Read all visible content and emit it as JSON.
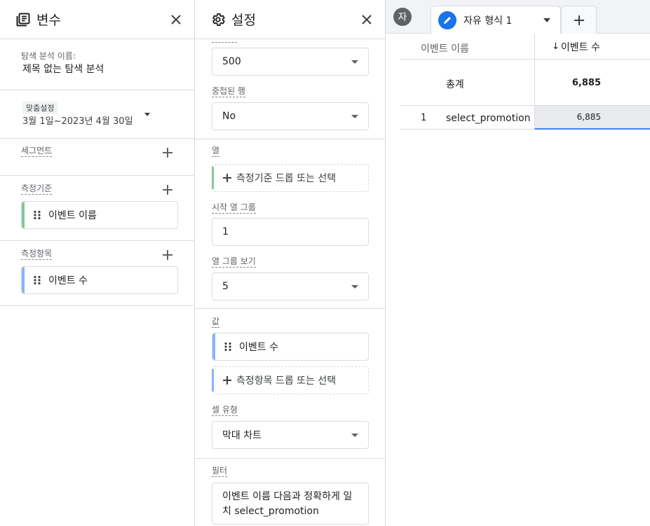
{
  "vars_panel": {
    "title": "변수",
    "exploration_name_label": "탐색 분석 이름:",
    "exploration_name": "제목 없는 탐색 분석",
    "date_badge": "맞춤설정",
    "date_range": "3월 1일~2023년 4월 30일",
    "segments_label": "세그먼트",
    "dimensions_label": "측정기준",
    "dimension_item": "이벤트 이름",
    "metrics_label": "측정항목",
    "metric_item": "이벤트 수"
  },
  "settings_panel": {
    "title": "설정",
    "rows_value": "500",
    "nested_rows_label": "중첩된 행",
    "nested_rows_value": "No",
    "columns_label": "열",
    "columns_drop": "측정기준 드롭 또는 선택",
    "start_col_group_label": "시작 열 그룹",
    "start_col_group_value": "1",
    "show_col_groups_label": "열 그룹 보기",
    "show_col_groups_value": "5",
    "values_label": "값",
    "value_item": "이벤트 수",
    "values_drop": "측정항목 드롭 또는 선택",
    "cell_type_label": "셀 유형",
    "cell_type_value": "막대 차트",
    "filters_label": "필터",
    "filter_text": "이벤트 이름 다음과 정확하게 일치 select_promotion"
  },
  "report": {
    "avatar_letter": "자",
    "tab_name": "자유 형식 1",
    "table": {
      "col_dimension": "이벤트 이름",
      "col_metric": "이벤트 수",
      "sort_arrow": "↓",
      "total_label": "총계",
      "total_value": "6,885",
      "rows": [
        {
          "index": "1",
          "name": "select_promotion",
          "value": "6,885"
        }
      ]
    }
  },
  "colors": {
    "dimension_accent": "#81c995",
    "metric_accent": "#8ab4f8",
    "tab_icon": "#1a73e8",
    "highlight_underline": "#4285f4"
  },
  "icons": {
    "vars_header": "list-document-icon",
    "settings_header": "gear-icon",
    "close": "close-icon",
    "add": "plus-icon",
    "grip": "drag-handle-icon",
    "tab": "pencil-icon"
  }
}
